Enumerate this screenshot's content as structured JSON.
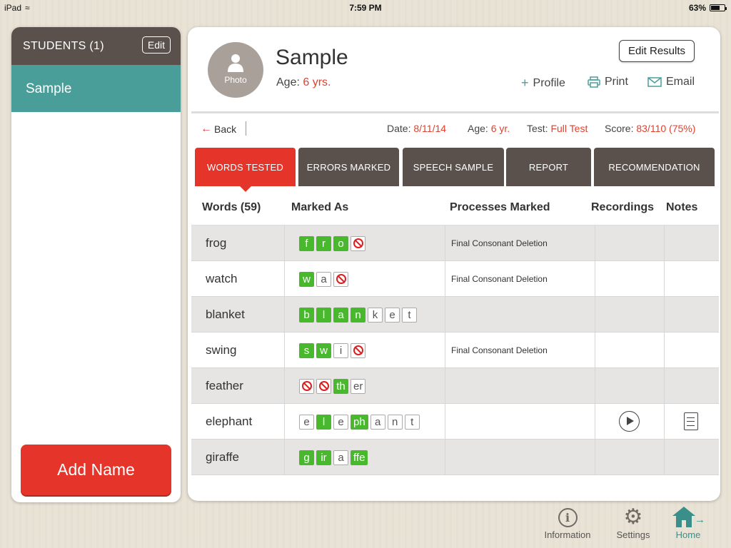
{
  "status_bar": {
    "device": "iPad",
    "time": "7:59 PM",
    "battery": "63%"
  },
  "sidebar": {
    "title": "STUDENTS (1)",
    "edit_label": "Edit",
    "students": [
      "Sample"
    ],
    "add_button": "Add Name",
    "header_color": "#5a514d",
    "selected_color": "#4a9e9a",
    "add_color": "#e5352b"
  },
  "profile": {
    "photo_label": "Photo",
    "name": "Sample",
    "age_label": "Age:",
    "age_value": "6 yrs.",
    "edit_results": "Edit Results",
    "actions": {
      "profile": {
        "label": "Profile",
        "icon": "plus-icon"
      },
      "print": {
        "label": "Print",
        "icon": "printer-icon"
      },
      "email": {
        "label": "Email",
        "icon": "envelope-icon"
      }
    }
  },
  "info_bar": {
    "back": "Back",
    "date_label": "Date:",
    "date_value": "8/11/14",
    "age_label": "Age:",
    "age_value": "6 yr.",
    "test_label": "Test:",
    "test_value": "Full Test",
    "score_label": "Score:",
    "score_value": "83/110 (75%)"
  },
  "tabs": [
    {
      "label": "WORDS TESTED",
      "active": true
    },
    {
      "label": "ERRORS MARKED",
      "active": false
    },
    {
      "label": "SPEECH SAMPLE",
      "active": false
    },
    {
      "label": "REPORT",
      "active": false
    },
    {
      "label": "RECOMMENDATION",
      "active": false
    }
  ],
  "table": {
    "headers": [
      "Words (59)",
      "Marked As",
      "Processes Marked",
      "Recordings",
      "Notes"
    ],
    "rows": [
      {
        "word": "frog",
        "letters": [
          {
            "t": "f",
            "s": "g"
          },
          {
            "t": "r",
            "s": "g"
          },
          {
            "t": "o",
            "s": "g"
          },
          {
            "t": "",
            "s": "x"
          }
        ],
        "process": "Final Consonant Deletion",
        "recording": false,
        "note": false
      },
      {
        "word": "watch",
        "letters": [
          {
            "t": "w",
            "s": "g"
          },
          {
            "t": "a",
            "s": "n"
          },
          {
            "t": "",
            "s": "x"
          }
        ],
        "process": "Final Consonant Deletion",
        "recording": false,
        "note": false
      },
      {
        "word": "blanket",
        "letters": [
          {
            "t": "b",
            "s": "g"
          },
          {
            "t": "l",
            "s": "g"
          },
          {
            "t": "a",
            "s": "g"
          },
          {
            "t": "n",
            "s": "g"
          },
          {
            "t": "k",
            "s": "n"
          },
          {
            "t": "e",
            "s": "n"
          },
          {
            "t": "t",
            "s": "n"
          }
        ],
        "process": "",
        "recording": false,
        "note": false
      },
      {
        "word": "swing",
        "letters": [
          {
            "t": "s",
            "s": "g"
          },
          {
            "t": "w",
            "s": "g"
          },
          {
            "t": "i",
            "s": "n"
          },
          {
            "t": "",
            "s": "x"
          }
        ],
        "process": "Final Consonant Deletion",
        "recording": false,
        "note": false
      },
      {
        "word": "feather",
        "letters": [
          {
            "t": "",
            "s": "x"
          },
          {
            "t": "",
            "s": "x"
          },
          {
            "t": "th",
            "s": "g"
          },
          {
            "t": "er",
            "s": "n"
          }
        ],
        "process": "",
        "recording": false,
        "note": false
      },
      {
        "word": "elephant",
        "letters": [
          {
            "t": "e",
            "s": "n"
          },
          {
            "t": "l",
            "s": "g"
          },
          {
            "t": "e",
            "s": "n"
          },
          {
            "t": "ph",
            "s": "g"
          },
          {
            "t": "a",
            "s": "n"
          },
          {
            "t": "n",
            "s": "n"
          },
          {
            "t": "t",
            "s": "n"
          }
        ],
        "process": "",
        "recording": true,
        "note": true
      },
      {
        "word": "giraffe",
        "letters": [
          {
            "t": "g",
            "s": "g"
          },
          {
            "t": "ir",
            "s": "g"
          },
          {
            "t": "a",
            "s": "n"
          },
          {
            "t": "ffe",
            "s": "g"
          }
        ],
        "process": "",
        "recording": false,
        "note": false
      }
    ]
  },
  "bottom_nav": [
    {
      "label": "Information",
      "icon": "info-icon"
    },
    {
      "label": "Settings",
      "icon": "gear-icon"
    },
    {
      "label": "Home",
      "icon": "home-icon"
    }
  ],
  "colors": {
    "accent_red": "#e2402e",
    "correct_green": "#48b92c",
    "teal": "#4a9e9a"
  }
}
